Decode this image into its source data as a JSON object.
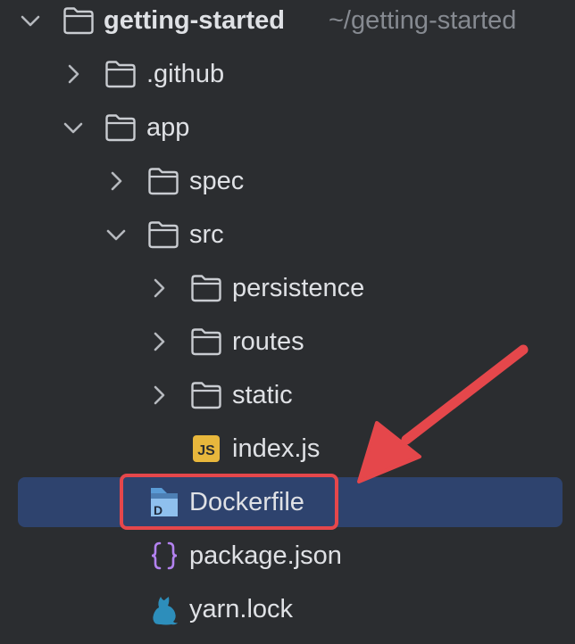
{
  "tree": {
    "root": {
      "name": "getting-started",
      "path": "~/getting-started",
      "expanded": true
    },
    "items": [
      {
        "name": ".github",
        "type": "folder",
        "expanded": false
      },
      {
        "name": "app",
        "type": "folder",
        "expanded": true
      },
      {
        "name": "spec",
        "type": "folder",
        "expanded": false
      },
      {
        "name": "src",
        "type": "folder",
        "expanded": true
      },
      {
        "name": "persistence",
        "type": "folder",
        "expanded": false
      },
      {
        "name": "routes",
        "type": "folder",
        "expanded": false
      },
      {
        "name": "static",
        "type": "folder",
        "expanded": false
      },
      {
        "name": "index.js",
        "type": "file",
        "icon": "javascript-file-icon",
        "icon_text": "JS"
      },
      {
        "name": "Dockerfile",
        "type": "file",
        "icon": "docker-file-icon",
        "icon_text": "D",
        "selected": true
      },
      {
        "name": "package.json",
        "type": "file",
        "icon": "json-braces-icon"
      },
      {
        "name": "yarn.lock",
        "type": "file",
        "icon": "yarn-cat-icon"
      }
    ]
  },
  "colors": {
    "background": "#2b2d30",
    "selection": "#2e436e",
    "annotation": "#e5474b",
    "js_badge": "#e8b73c",
    "json_braces": "#b382f0",
    "yarn": "#2d8ebb",
    "docker": "#5a9bd6"
  }
}
